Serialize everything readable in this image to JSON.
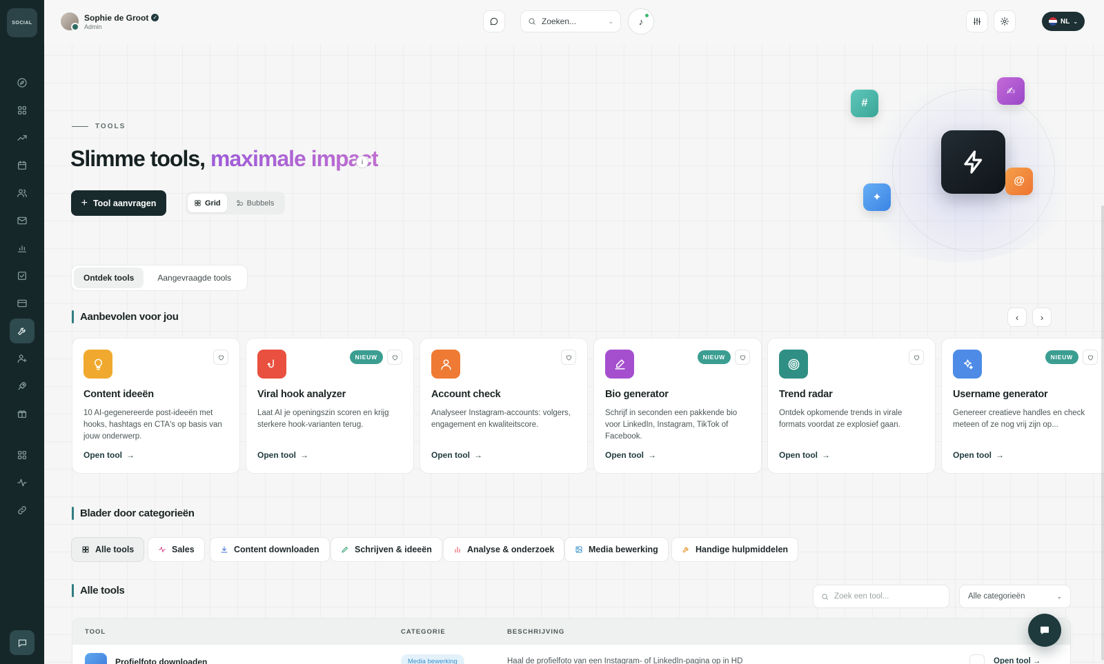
{
  "sidebar": {
    "logo_text": "SOCIAL",
    "items": [
      {
        "name": "compass-icon"
      },
      {
        "name": "dashboard-icon"
      },
      {
        "name": "trending-icon"
      },
      {
        "name": "calendar-icon"
      },
      {
        "name": "users-icon"
      },
      {
        "name": "mail-icon"
      },
      {
        "name": "bar-chart-icon"
      },
      {
        "name": "checklist-icon"
      },
      {
        "name": "card-icon"
      },
      {
        "name": "wrench-icon",
        "active": true
      },
      {
        "name": "user-plus-icon"
      },
      {
        "name": "rocket-icon"
      },
      {
        "name": "gift-icon"
      },
      {
        "name": "apps-icon"
      },
      {
        "name": "activity-icon"
      },
      {
        "name": "link-icon"
      }
    ]
  },
  "header": {
    "user_name": "Sophie de Groot",
    "user_role": "Admin",
    "search_placeholder": "Zoeken...",
    "language": "NL"
  },
  "hero": {
    "eyebrow": "TOOLS",
    "title_plain": "Slimme tools, ",
    "title_accent": "maximale impact",
    "request_button": "Tool aanvragen",
    "view_grid": "Grid",
    "view_bubbles": "Bubbels",
    "float_hash": "#",
    "float_at": "@",
    "float_pen": "✍",
    "float_spark": "✦"
  },
  "tabs": {
    "discover": "Ontdek tools",
    "requested": "Aangevraagde tools"
  },
  "recommended": {
    "heading": "Aanbevolen voor jou",
    "open_label": "Open tool",
    "new_badge": "NIEUW",
    "cards": [
      {
        "title": "Content ideeën",
        "desc": "10 AI-gegenereerde post-ideeën met hooks, hashtags en CTA's op basis van jouw onderwerp.",
        "icon": "lightbulb-icon",
        "color": "#f0a92e",
        "is_new": false
      },
      {
        "title": "Viral hook analyzer",
        "desc": "Laat AI je openingszin scoren en krijg sterkere hook-varianten terug.",
        "icon": "hook-icon",
        "color": "#e9503f",
        "is_new": true
      },
      {
        "title": "Account check",
        "desc": "Analyseer Instagram-accounts: volgers, engagement en kwaliteitscore.",
        "icon": "user-icon",
        "color": "#ee7a34",
        "is_new": false
      },
      {
        "title": "Bio generator",
        "desc": "Schrijf in seconden een pakkende bio voor LinkedIn, Instagram, TikTok of Facebook.",
        "icon": "pen-icon",
        "color": "#a54fcf",
        "is_new": true
      },
      {
        "title": "Trend radar",
        "desc": "Ontdek opkomende trends in virale formats voordat ze explosief gaan.",
        "icon": "target-icon",
        "color": "#2f8f84",
        "is_new": false
      },
      {
        "title": "Username generator",
        "desc": "Genereer creatieve handles en check meteen of ze nog vrij zijn op...",
        "icon": "sparkles-icon",
        "color": "#4d8be6",
        "is_new": true
      }
    ]
  },
  "categories": {
    "heading": "Blader door categorieën",
    "items": [
      {
        "label": "Alle tools",
        "icon": "grid-icon",
        "color": "#1e2829"
      },
      {
        "label": "Sales",
        "icon": "pulse-icon",
        "color": "#d64a8f"
      },
      {
        "label": "Content downloaden",
        "icon": "download-icon",
        "color": "#3d6fd6"
      },
      {
        "label": "Schrijven & ideeën",
        "icon": "pencil-icon",
        "color": "#2f9e6e"
      },
      {
        "label": "Analyse & onderzoek",
        "icon": "chart-icon",
        "color": "#e0485a"
      },
      {
        "label": "Media bewerking",
        "icon": "image-icon",
        "color": "#3a8fcb"
      },
      {
        "label": "Handige hulpmiddelen",
        "icon": "wrench-icon",
        "color": "#e8962a"
      }
    ]
  },
  "all_tools": {
    "heading": "Alle tools",
    "search_placeholder": "Zoek een tool...",
    "category_select": "Alle categorieën",
    "columns": [
      "TOOL",
      "CATEGORIE",
      "BESCHRIJVING"
    ],
    "rows": [
      {
        "name": "Profielfoto downloaden",
        "category": "Media bewerking",
        "description": "Haal de profielfoto van een Instagram- of LinkedIn-pagina op in HD",
        "action": "Open tool"
      }
    ]
  }
}
